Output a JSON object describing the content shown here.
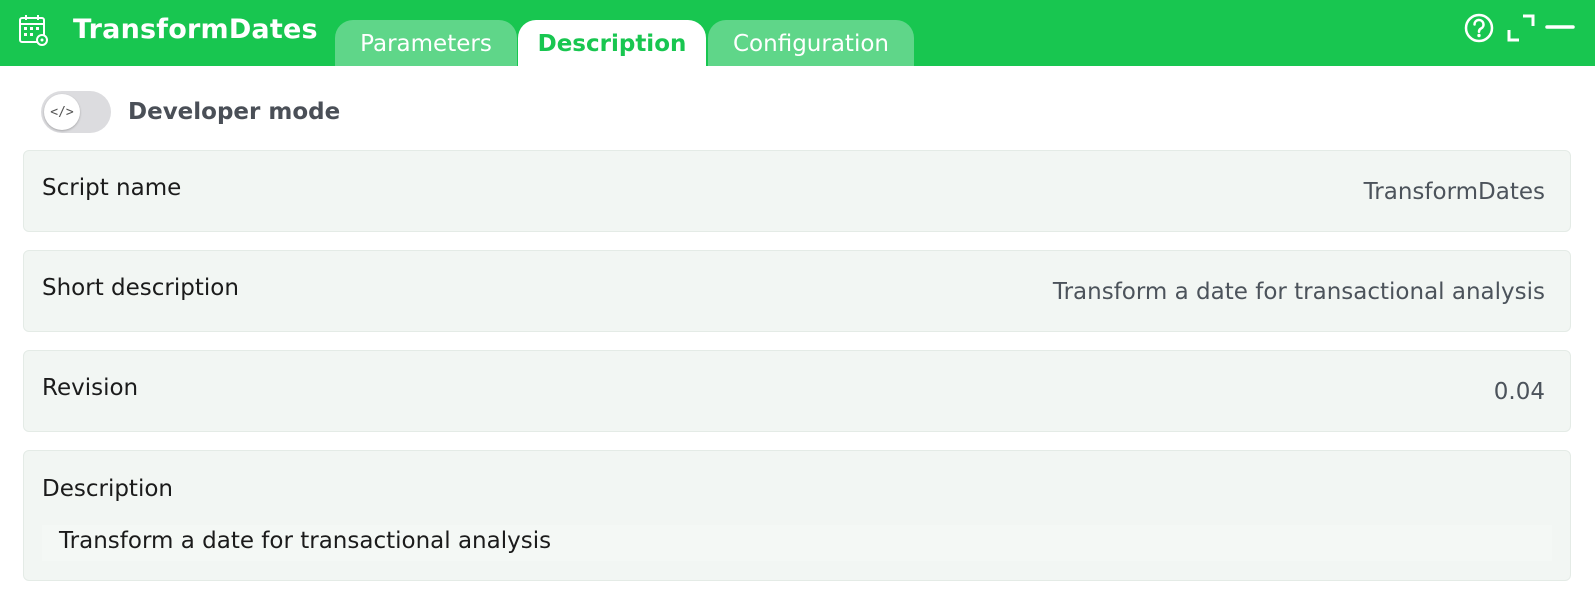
{
  "app": {
    "title": "TransformDates",
    "icon": "calendar-settings-icon",
    "accent_color": "#18c650"
  },
  "tabs": [
    {
      "label": "Parameters",
      "active": false
    },
    {
      "label": "Description",
      "active": true
    },
    {
      "label": "Configuration",
      "active": false
    }
  ],
  "header_buttons": {
    "help_icon": "help-icon",
    "expand_icon": "expand-icon",
    "minimize_icon": "minimize-icon"
  },
  "developer_mode": {
    "label": "Developer mode",
    "toggle_glyph": "</>",
    "enabled": false
  },
  "fields": {
    "script_name": {
      "label": "Script name",
      "value": "TransformDates"
    },
    "short_description": {
      "label": "Short description",
      "value": "Transform a date for transactional analysis"
    },
    "revision": {
      "label": "Revision",
      "value": "0.04"
    },
    "description": {
      "label": "Description",
      "value": "Transform a date for transactional analysis"
    }
  }
}
